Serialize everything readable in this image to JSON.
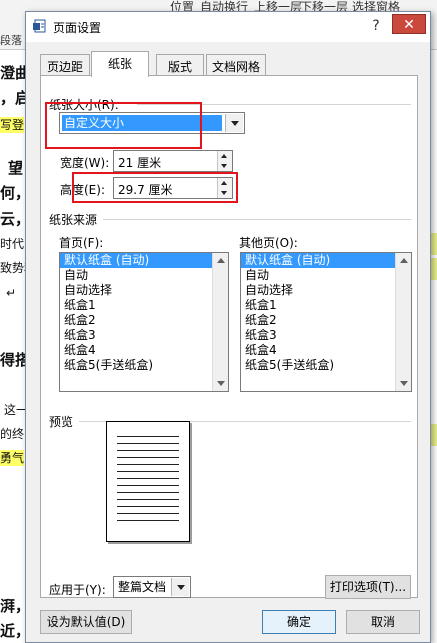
{
  "background": {
    "ribbon_items": [
      "位置",
      "自动换行",
      "上移一层",
      "下移一层",
      "选择窗格"
    ],
    "paragraph_group": "段落",
    "fragments": [
      "澄曲",
      "，启",
      "写登",
      "望",
      "何，",
      "云，",
      "时代",
      "致势和",
      "↵",
      "得搭",
      "这一",
      "的终",
      "勇气",
      "湃，",
      "近，"
    ]
  },
  "dialog": {
    "title": "页面设置",
    "help": "?",
    "close": "✕",
    "tabs": [
      {
        "label": "页边距"
      },
      {
        "label": "纸张"
      },
      {
        "label": "版式"
      },
      {
        "label": "文档网格"
      }
    ],
    "paper_size": {
      "group_label": "纸张大小(R):",
      "value": "自定义大小",
      "width_label": "宽度(W):",
      "width_value": "21 厘米",
      "height_label": "高度(E):",
      "height_value": "29.7 厘米"
    },
    "paper_source": {
      "group_label": "纸张来源",
      "first_page_label": "首页(F):",
      "other_pages_label": "其他页(O):",
      "first_page_items": [
        "默认纸盒 (自动)",
        "自动",
        "自动选择",
        "纸盒1",
        "纸盒2",
        "纸盒3",
        "纸盒4",
        "纸盒5(手送纸盒)"
      ],
      "other_pages_items": [
        "默认纸盒 (自动)",
        "自动",
        "自动选择",
        "纸盒1",
        "纸盒2",
        "纸盒3",
        "纸盒4",
        "纸盒5(手送纸盒)"
      ],
      "selected_index": 0
    },
    "preview": {
      "group_label": "预览",
      "apply_to_label": "应用于(Y):",
      "apply_to_value": "整篇文档",
      "print_options": "打印选项(T)..."
    },
    "buttons": {
      "set_default": "设为默认值(D)",
      "ok": "确定",
      "cancel": "取消"
    }
  }
}
